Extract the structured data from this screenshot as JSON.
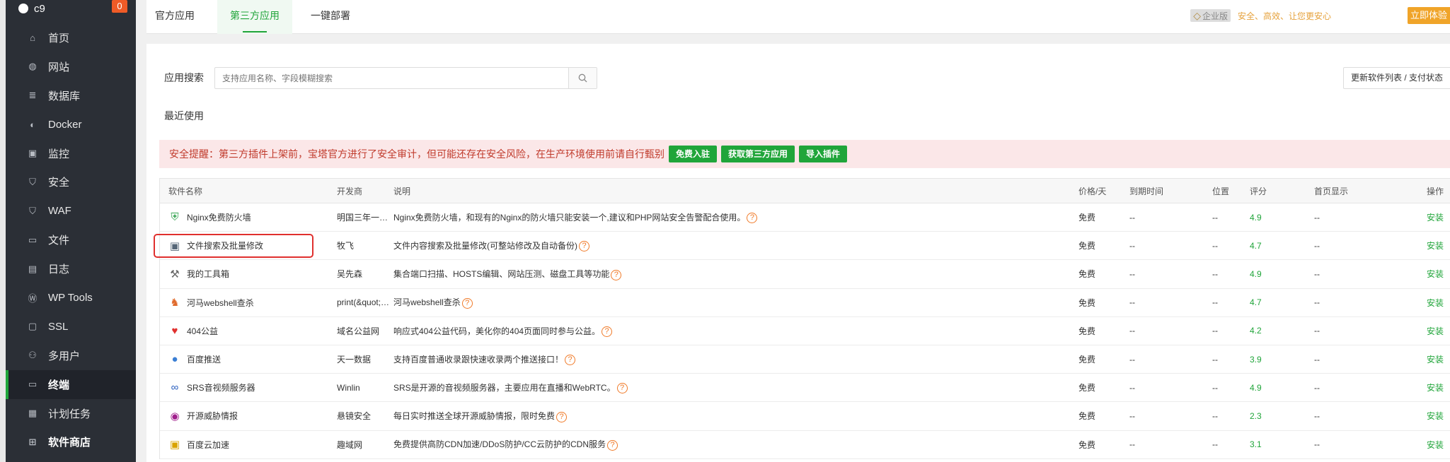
{
  "sidebar": {
    "server_name": "c9",
    "badge": "0",
    "items": [
      {
        "label": "首页",
        "icon": "home-icon"
      },
      {
        "label": "网站",
        "icon": "globe-icon"
      },
      {
        "label": "数据库",
        "icon": "database-icon"
      },
      {
        "label": "Docker",
        "icon": "docker-icon"
      },
      {
        "label": "监控",
        "icon": "monitor-icon"
      },
      {
        "label": "安全",
        "icon": "shield-icon"
      },
      {
        "label": "WAF",
        "icon": "waf-shield-icon"
      },
      {
        "label": "文件",
        "icon": "folder-icon"
      },
      {
        "label": "日志",
        "icon": "log-icon"
      },
      {
        "label": "WP Tools",
        "icon": "wordpress-icon"
      },
      {
        "label": "SSL",
        "icon": "ssl-icon"
      },
      {
        "label": "多用户",
        "icon": "users-icon"
      },
      {
        "label": "终端",
        "icon": "terminal-icon"
      },
      {
        "label": "计划任务",
        "icon": "calendar-icon"
      },
      {
        "label": "软件商店",
        "icon": "grid-icon"
      }
    ]
  },
  "tabs": {
    "official": "官方应用",
    "third_party": "第三方应用",
    "one_click": "一键部署"
  },
  "enterprise": {
    "label": "企业版",
    "slogan": "安全、高效、让您更安心",
    "try_button": "立即体验"
  },
  "search": {
    "label": "应用搜索",
    "placeholder": "支持应用名称、字段模糊搜索",
    "update_button": "更新软件列表 / 支付状态"
  },
  "recent_label": "最近使用",
  "alert": {
    "text": "安全提醒：第三方插件上架前，宝塔官方进行了安全审计，但可能还存在安全风险，在生产环境使用前请自行甄别",
    "btn_join": "免费入驻",
    "btn_get": "获取第三方应用",
    "btn_import": "导入插件"
  },
  "table": {
    "headers": {
      "name": "软件名称",
      "dev": "开发商",
      "desc": "说明",
      "price": "价格/天",
      "expire": "到期时间",
      "position": "位置",
      "score": "评分",
      "home": "首页显示",
      "op": "操作"
    },
    "rows": [
      {
        "name": "Nginx免费防火墙",
        "dev": "明国三年一…",
        "desc": "Nginx免费防火墙，和现有的Nginx的防火墙只能安装一个,建议和PHP网站安全告警配合使用。",
        "price": "免费",
        "expire": "--",
        "position": "--",
        "score": "4.9",
        "home": "--",
        "op": "安装",
        "icon": "nginx-firewall-icon",
        "icon_color": "#3aa655"
      },
      {
        "name": "文件搜索及批量修改",
        "dev": "牧飞",
        "desc": "文件内容搜索及批量修改(可整站修改及自动备份)",
        "price": "免费",
        "expire": "--",
        "position": "--",
        "score": "4.7",
        "home": "--",
        "op": "安装",
        "icon": "file-search-icon",
        "icon_color": "#556677"
      },
      {
        "name": "我的工具箱",
        "dev": "吴先森",
        "desc": "集合端口扫描、HOSTS编辑、网站压测、磁盘工具等功能",
        "price": "免费",
        "expire": "--",
        "position": "--",
        "score": "4.9",
        "home": "--",
        "op": "安装",
        "icon": "toolbox-icon",
        "icon_color": "#666666"
      },
      {
        "name": "河马webshell查杀",
        "dev": "print(&quot;…",
        "desc": "河马webshell查杀",
        "price": "免费",
        "expire": "--",
        "position": "--",
        "score": "4.7",
        "home": "--",
        "op": "安装",
        "icon": "hippo-icon",
        "icon_color": "#e06a2c"
      },
      {
        "name": "404公益",
        "dev": "域名公益网",
        "desc": "响应式404公益代码，美化你的404页面同时参与公益。",
        "price": "免费",
        "expire": "--",
        "position": "--",
        "score": "4.2",
        "home": "--",
        "op": "安装",
        "icon": "heart-icon",
        "icon_color": "#e0302e"
      },
      {
        "name": "百度推送",
        "dev": "天一数据",
        "desc": "支持百度普通收录跟快速收录两个推送接口！",
        "price": "免费",
        "expire": "--",
        "position": "--",
        "score": "3.9",
        "home": "--",
        "op": "安装",
        "icon": "baidu-push-icon",
        "icon_color": "#3b7fd4"
      },
      {
        "name": "SRS音视频服务器",
        "dev": "Winlin",
        "desc": "SRS是开源的音视频服务器，主要应用在直播和WebRTC。",
        "price": "免费",
        "expire": "--",
        "position": "--",
        "score": "4.9",
        "home": "--",
        "op": "安装",
        "icon": "srs-icon",
        "icon_color": "#2a5fbf"
      },
      {
        "name": "开源威胁情报",
        "dev": "悬镜安全",
        "desc": "每日实时推送全球开源威胁情报，限时免费",
        "price": "免费",
        "expire": "--",
        "position": "--",
        "score": "2.3",
        "home": "--",
        "op": "安装",
        "icon": "threat-intel-icon",
        "icon_color": "#a0208c"
      },
      {
        "name": "百度云加速",
        "dev": "趣域网",
        "desc": "免费提供高防CDN加速/DDoS防护/CC云防护的CDN服务",
        "price": "免费",
        "expire": "--",
        "position": "--",
        "score": "3.1",
        "home": "--",
        "op": "安装",
        "icon": "baidu-cloud-icon",
        "icon_color": "#d9a300"
      }
    ]
  }
}
